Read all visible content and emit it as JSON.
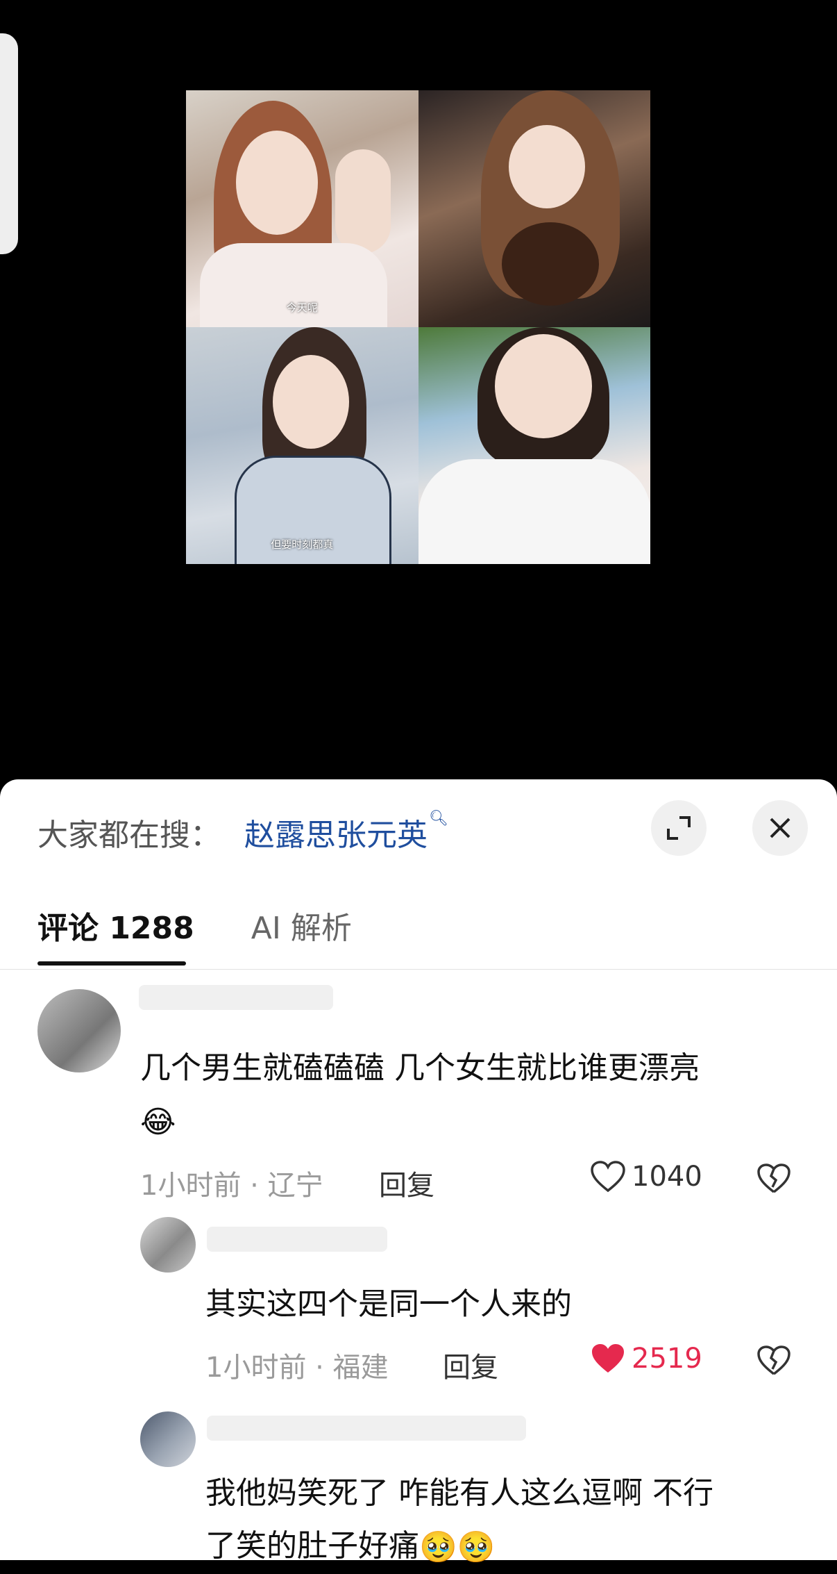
{
  "image_captions": {
    "top_left": "今天呢",
    "bottom_left": "但要时刻都真"
  },
  "search_bar": {
    "label": "大家都在搜：",
    "query": "赵露思张元英"
  },
  "tabs": [
    {
      "label": "评论 1288"
    },
    {
      "label": "AI 解析"
    }
  ],
  "comments": [
    {
      "text_line1": "几个男生就磕磕磕 几个女生就比谁更漂亮",
      "emoji": "😂",
      "time": "1小时前",
      "location": "辽宁",
      "reply": "回复",
      "likes": "1040",
      "liked": false
    },
    {
      "text_line1": "其实这四个是同一个人来的",
      "time": "1小时前",
      "location": "福建",
      "reply": "回复",
      "likes": "2519",
      "liked": true
    },
    {
      "text_line1": "我他妈笑死了 咋能有人这么逗啊 不行",
      "text_line2": "了笑的肚子好痛",
      "emoji": "🥹🥹"
    }
  ],
  "colors": {
    "link_blue": "#1f4e9e",
    "like_red": "#e5294e"
  }
}
